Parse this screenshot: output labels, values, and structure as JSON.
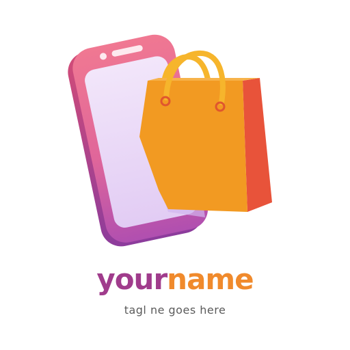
{
  "logo": {
    "icon": "phone-with-shopping-bag-icon",
    "brand_first": "your",
    "brand_second": "name",
    "tagline": "tagl ne goes here"
  },
  "colors": {
    "brand_purple": "#A03C8C",
    "brand_orange": "#F08A2C",
    "phone_pink": "#EC6E8A",
    "phone_screen": "#E9D6F6",
    "bag_orange": "#F29A22",
    "bag_side": "#E8533A",
    "handle_yellow": "#F6B52C",
    "tagline_gray": "#5a5a5a"
  }
}
